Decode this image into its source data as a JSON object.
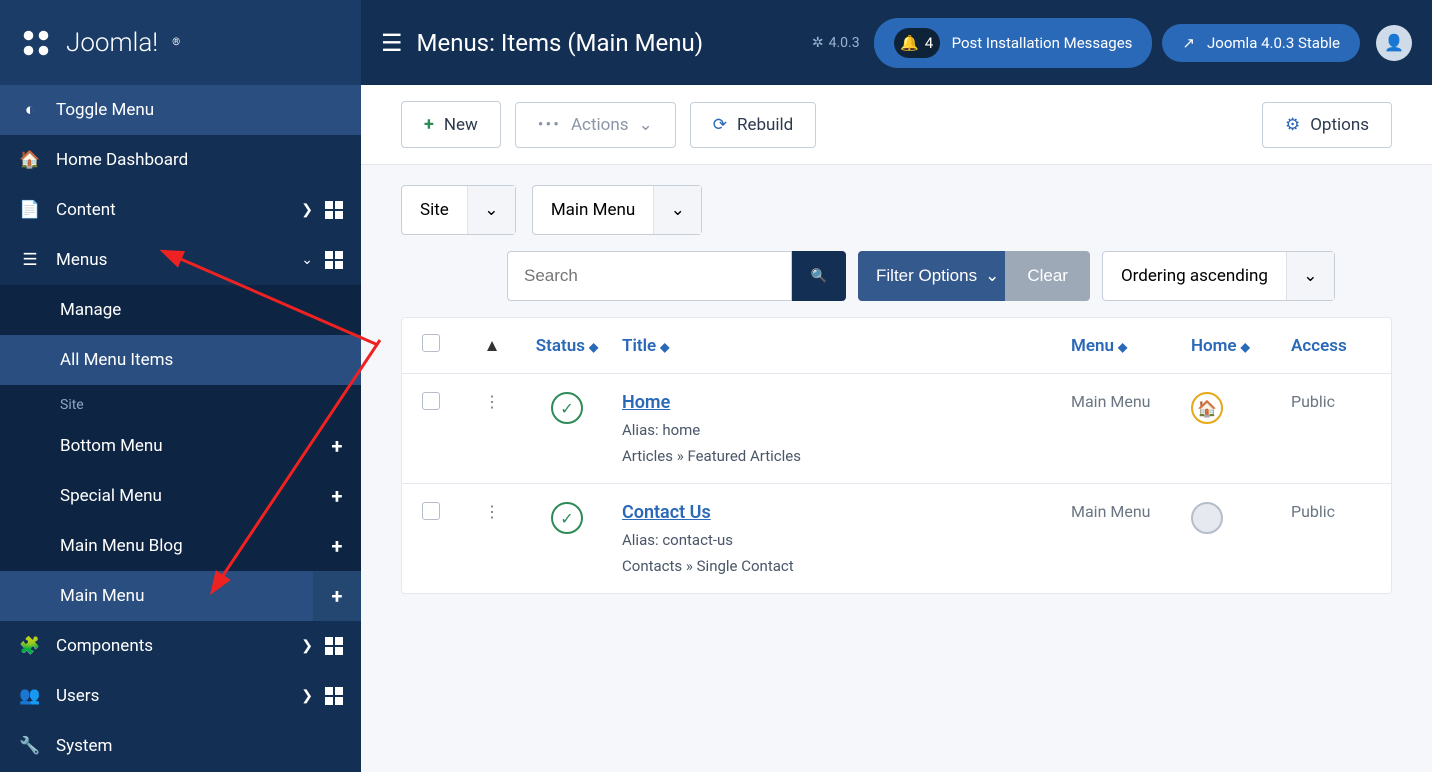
{
  "logo": "Joomla!",
  "version": "4.0.3",
  "sidebar": {
    "toggle": "Toggle Menu",
    "home": "Home Dashboard",
    "content": "Content",
    "menus": "Menus",
    "components": "Components",
    "users": "Users",
    "system": "System",
    "submenu": {
      "manage": "Manage",
      "allitems": "All Menu Items",
      "sitelabel": "Site",
      "bottom": "Bottom Menu",
      "special": "Special Menu",
      "blog": "Main Menu Blog",
      "main": "Main Menu"
    }
  },
  "header": {
    "title": "Menus: Items (Main Menu)",
    "notif_count": "4",
    "post_install": "Post Installation Messages",
    "stable": "Joomla 4.0.3 Stable"
  },
  "toolbar": {
    "new": "New",
    "actions": "Actions",
    "rebuild": "Rebuild",
    "options": "Options"
  },
  "filters": {
    "client": "Site",
    "menu": "Main Menu",
    "search_ph": "Search",
    "filter_opts": "Filter Options",
    "clear": "Clear",
    "ordering": "Ordering ascending"
  },
  "table": {
    "headers": {
      "status": "Status",
      "title": "Title",
      "menu": "Menu",
      "home": "Home",
      "access": "Access"
    },
    "rows": [
      {
        "title": "Home",
        "alias": "Alias: home",
        "path": "Articles » Featured Articles",
        "menu": "Main Menu",
        "access": "Public",
        "isHome": true
      },
      {
        "title": "Contact Us",
        "alias": "Alias: contact-us",
        "path": "Contacts » Single Contact",
        "menu": "Main Menu",
        "access": "Public",
        "isHome": false
      }
    ]
  }
}
